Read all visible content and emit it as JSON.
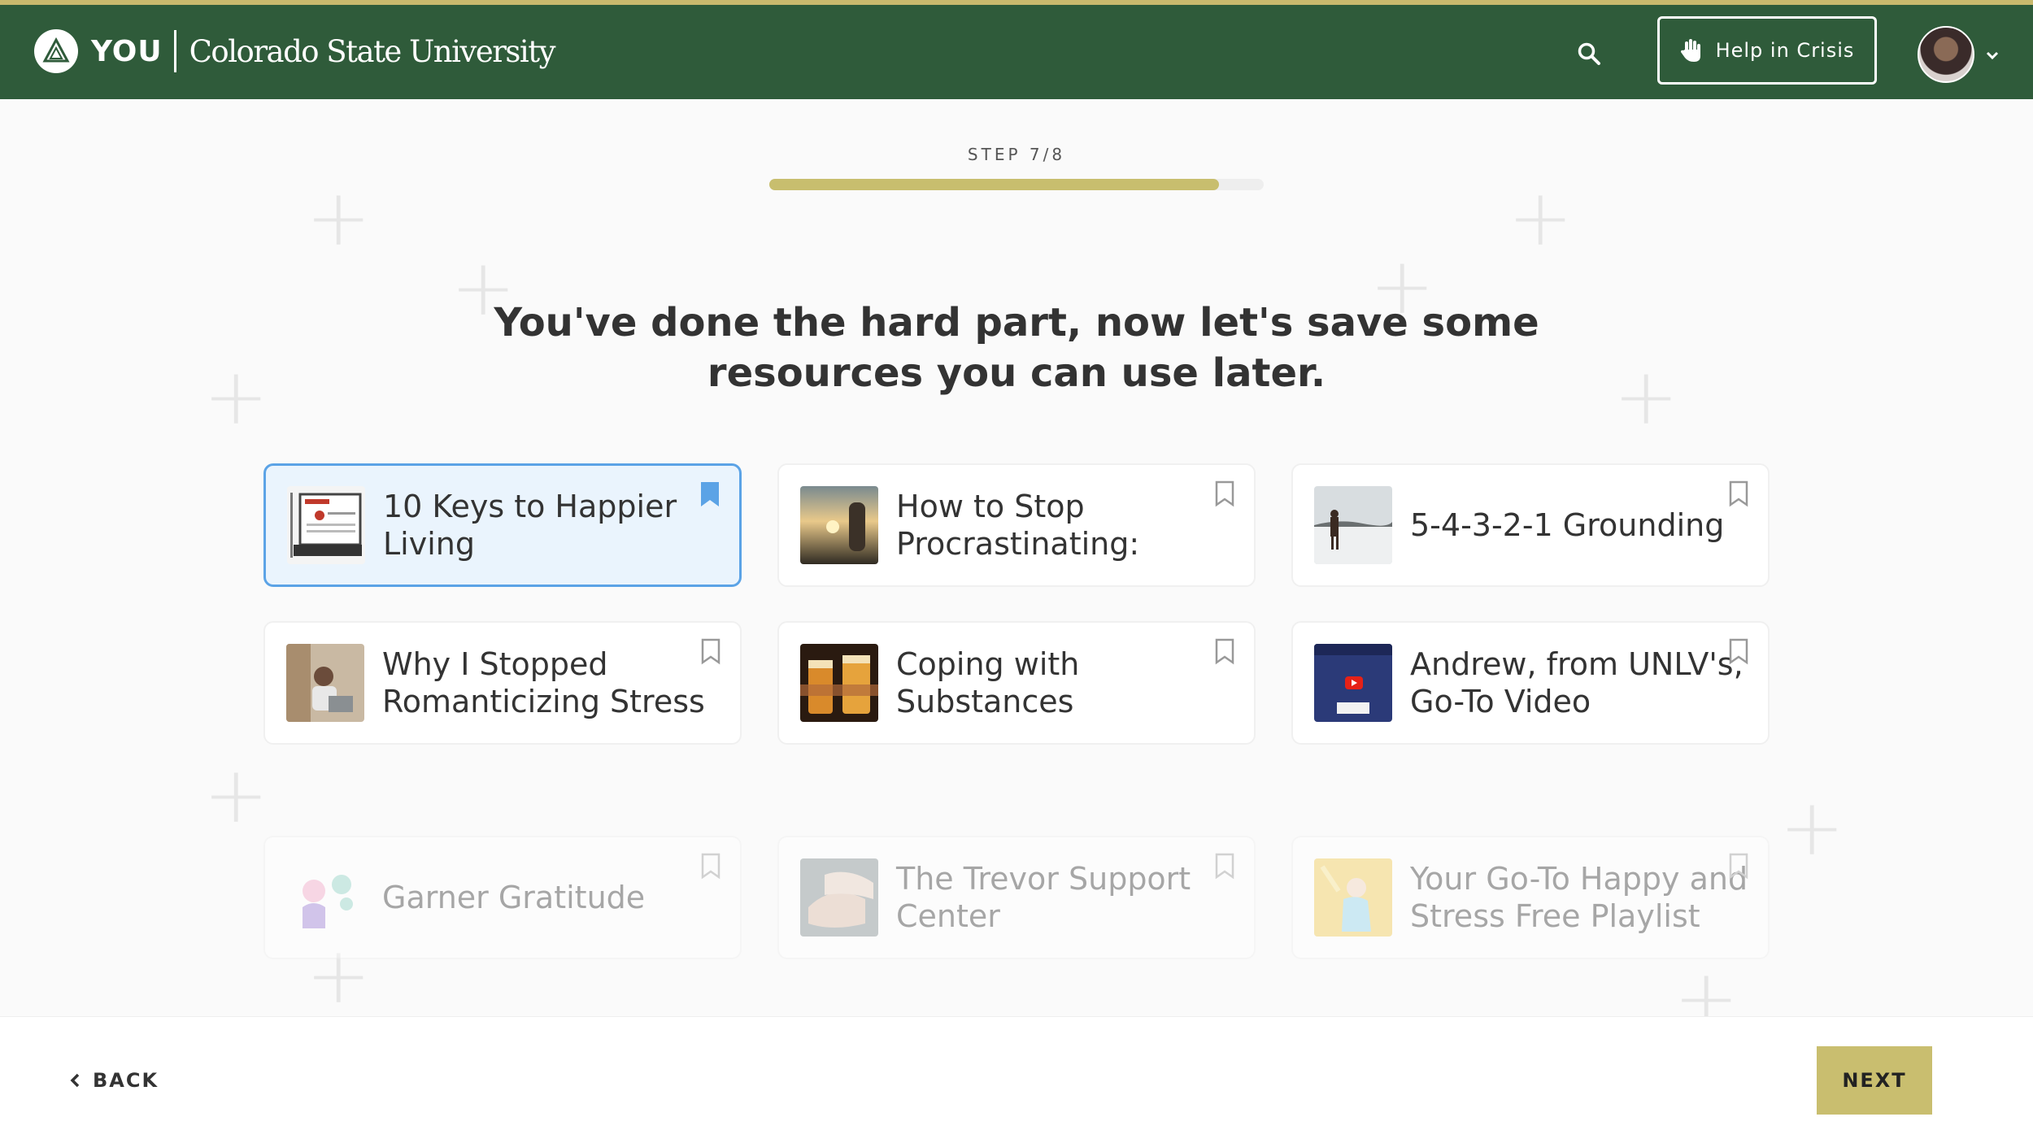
{
  "header": {
    "logo_text": "YOU",
    "university": "Colorado State University",
    "crisis_label": "Help in Crisis",
    "colors": {
      "bar": "#2f5b3a",
      "accent": "#c9b96d"
    },
    "icons": {
      "search": "search-icon",
      "crisis": "raised-hand-icon",
      "avatar_menu": "chevron-down-icon"
    }
  },
  "wizard": {
    "step_label": "STEP 7/8",
    "progress_fraction": 0.91,
    "headline": "You've done the hard part, now let's save some resources you can use later."
  },
  "resources": [
    {
      "title": "10 Keys to Happier Living",
      "selected": true,
      "faded": false
    },
    {
      "title": "How to Stop Procrastinating:",
      "selected": false,
      "faded": false
    },
    {
      "title": "5-4-3-2-1 Grounding",
      "selected": false,
      "faded": false
    },
    {
      "title": "Why I Stopped Romanticizing Stress",
      "selected": false,
      "faded": false
    },
    {
      "title": "Coping with Substances",
      "selected": false,
      "faded": false
    },
    {
      "title": "Andrew, from UNLV's, Go-To Video",
      "selected": false,
      "faded": false
    },
    {
      "title": "Garner Gratitude",
      "selected": false,
      "faded": true
    },
    {
      "title": "The Trevor Support Center",
      "selected": false,
      "faded": true
    },
    {
      "title": "Your Go-To Happy and Stress Free Playlist",
      "selected": false,
      "faded": true
    }
  ],
  "footer": {
    "back_label": "BACK",
    "next_label": "NEXT",
    "next_color": "#c9be6f"
  }
}
